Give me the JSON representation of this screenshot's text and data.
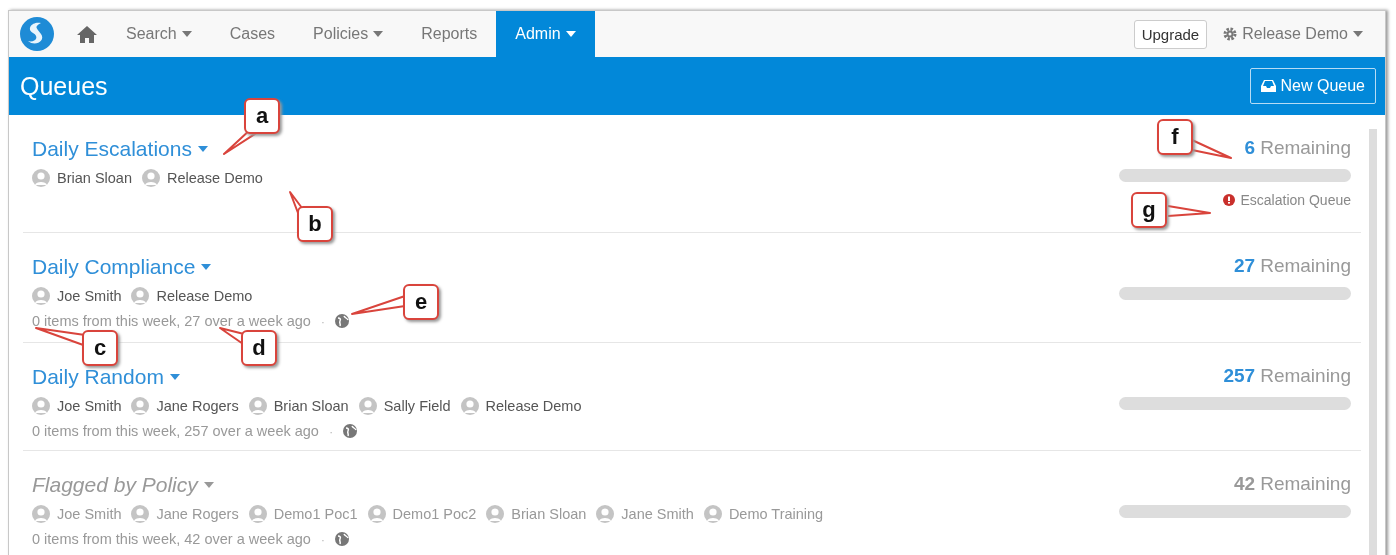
{
  "nav": {
    "items": [
      {
        "label": "Search",
        "dropdown": true,
        "selected": false
      },
      {
        "label": "Cases",
        "dropdown": false,
        "selected": false
      },
      {
        "label": "Policies",
        "dropdown": true,
        "selected": false
      },
      {
        "label": "Reports",
        "dropdown": false,
        "selected": false
      },
      {
        "label": "Admin",
        "dropdown": true,
        "selected": true
      }
    ],
    "upgrade": "Upgrade",
    "user_menu": "Release Demo"
  },
  "header": {
    "title": "Queues",
    "new_button": "New Queue"
  },
  "queues": [
    {
      "name": "Daily Escalations",
      "disabled": false,
      "members": [
        "Brian Sloan",
        "Release Demo"
      ],
      "count": "6",
      "remaining": "Remaining",
      "tag": "Escalation Queue"
    },
    {
      "name": "Daily Compliance",
      "disabled": false,
      "members": [
        "Joe Smith",
        "Release Demo"
      ],
      "stats": "0 items from this week, 27 over a week ago",
      "separator": "·",
      "count": "27",
      "remaining": "Remaining"
    },
    {
      "name": "Daily Random",
      "disabled": false,
      "members": [
        "Joe Smith",
        "Jane Rogers",
        "Brian Sloan",
        "Sally Field",
        "Release Demo"
      ],
      "stats": "0 items from this week, 257 over a week ago",
      "separator": "·",
      "count": "257",
      "remaining": "Remaining"
    },
    {
      "name": "Flagged by Policy",
      "disabled": true,
      "members": [
        "Joe Smith",
        "Jane Rogers",
        "Demo1 Poc1",
        "Demo1 Poc2",
        "Brian Sloan",
        "Jane Smith",
        "Demo Training"
      ],
      "stats": "0 items from this week, 42 over a week ago",
      "separator": "·",
      "count": "42",
      "remaining": "Remaining"
    }
  ],
  "callouts": [
    "a",
    "b",
    "c",
    "d",
    "e",
    "f",
    "g"
  ]
}
